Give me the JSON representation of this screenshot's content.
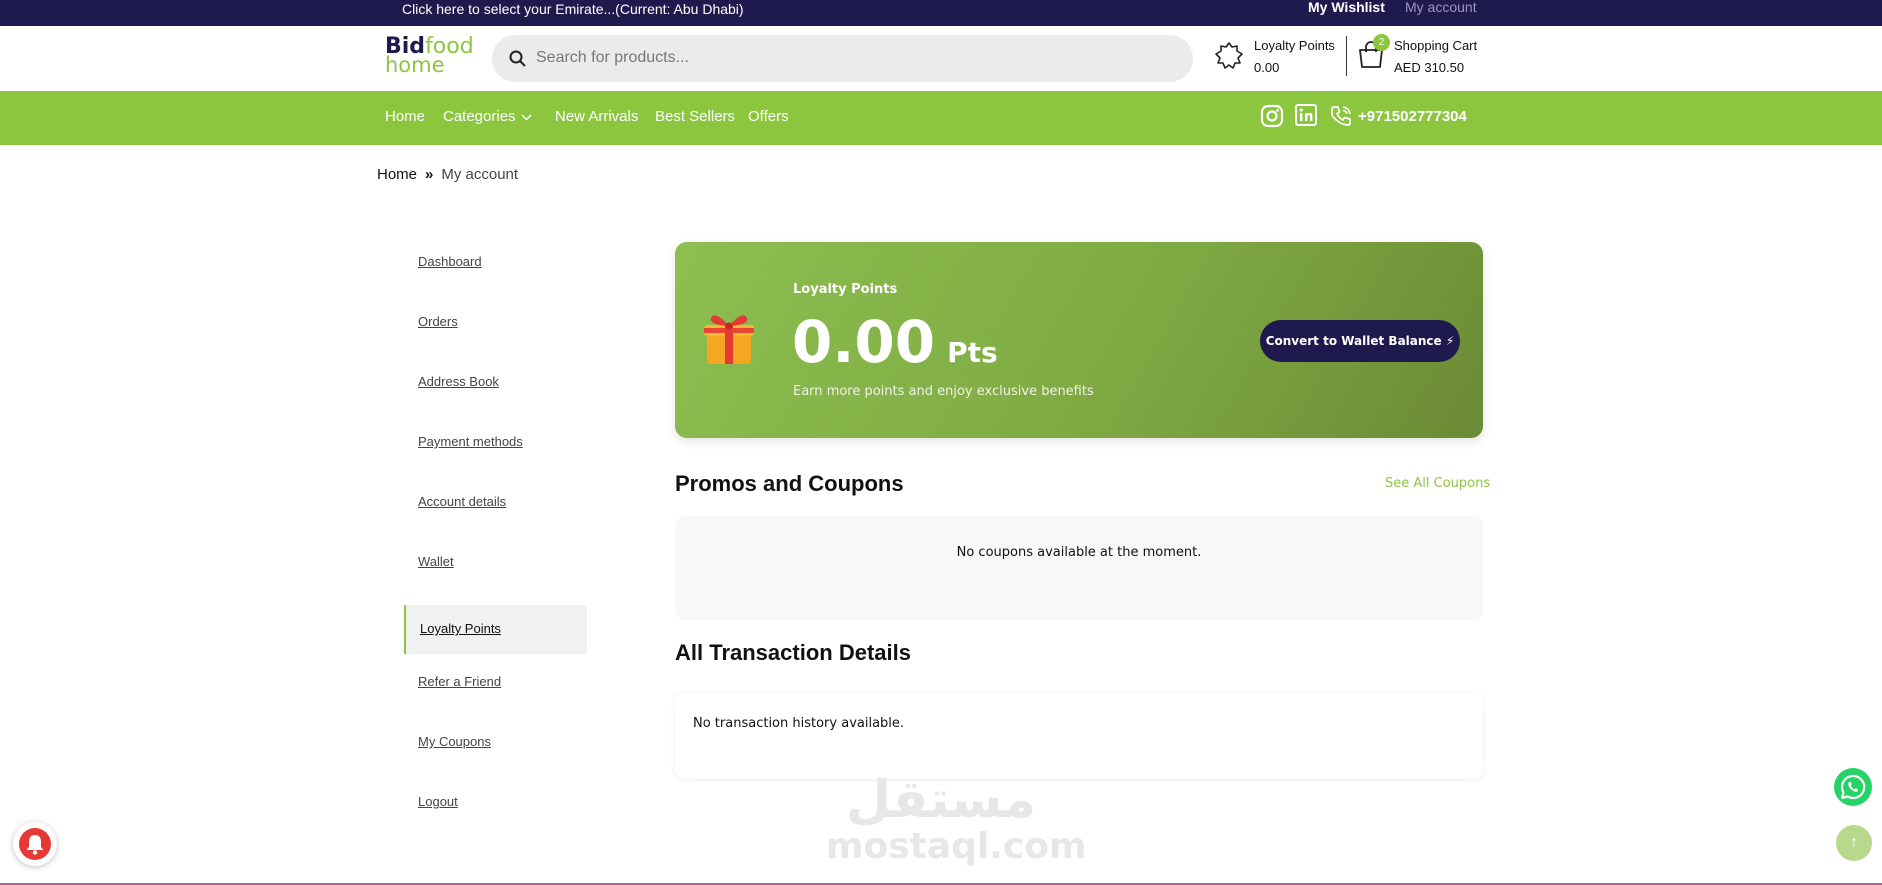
{
  "topbar": {
    "emirate_text": "Click here to select your Emirate...(Current: Abu Dhabi)",
    "wishlist": "My Wishlist",
    "account": "My account"
  },
  "header": {
    "logo": {
      "bid": "Bid",
      "food": "food",
      "home": "home"
    },
    "search_placeholder": "Search for products...",
    "loyalty_label": "Loyalty Points",
    "loyalty_value": "0.00",
    "cart_label": "Shopping Cart",
    "cart_value": "AED 310.50",
    "cart_count": "2"
  },
  "nav": {
    "items": [
      "Home",
      "Categories",
      "New Arrivals",
      "Best Sellers",
      "Offers"
    ],
    "phone": "+971502777304"
  },
  "breadcrumb": {
    "home": "Home",
    "separator": "»",
    "current": "My account"
  },
  "sidebar": {
    "items": [
      "Dashboard",
      "Orders",
      "Address Book",
      "Payment methods",
      "Account details",
      "Wallet",
      "Loyalty Points",
      "Refer a Friend",
      "My Coupons",
      "Logout"
    ],
    "active": "Loyalty Points"
  },
  "loyalty_card": {
    "label": "Loyalty Points",
    "points": "0.00",
    "unit": "Pts",
    "subtitle": "Earn more points and enjoy exclusive benefits",
    "convert_button": "Convert to Wallet Balance ⚡"
  },
  "promos": {
    "title": "Promos and Coupons",
    "see_all": "See All Coupons",
    "empty_message": "No coupons available at the moment."
  },
  "transactions": {
    "title": "All Transaction Details",
    "empty_message": "No transaction history available."
  },
  "watermark": {
    "arabic": "مستقل",
    "latin": "mostaql.com"
  },
  "floating": {
    "scroll_top_glyph": "↑"
  },
  "colors": {
    "brand_green": "#8cc63f",
    "brand_navy": "#1f1a4d",
    "whatsapp": "#25d366",
    "notification_red": "#e53935"
  }
}
